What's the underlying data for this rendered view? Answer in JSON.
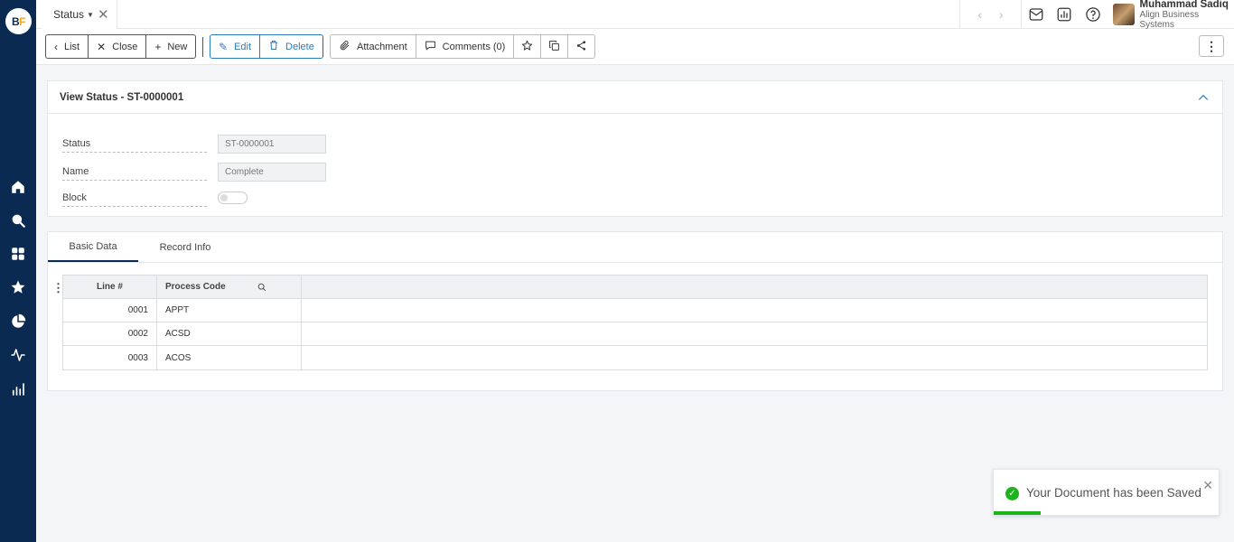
{
  "app": {
    "logo_b": "B",
    "logo_f": "F"
  },
  "sidebar": {
    "items": [
      {
        "icon": "home-icon"
      },
      {
        "icon": "search-icon"
      },
      {
        "icon": "apps-grid-icon"
      },
      {
        "icon": "star-icon"
      },
      {
        "icon": "pie-chart-icon"
      },
      {
        "icon": "activity-icon"
      },
      {
        "icon": "bar-chart-icon"
      }
    ]
  },
  "tabbar": {
    "active_tab": "Status",
    "close_glyph": "✕"
  },
  "user": {
    "name": "Muhammad Sadiq",
    "org": "Align Business Systems"
  },
  "toolbar": {
    "list_label": "List",
    "close_label": "Close",
    "new_label": "New",
    "edit_label": "Edit",
    "delete_label": "Delete",
    "attachment_label": "Attachment",
    "comments_label": "Comments (0)"
  },
  "form": {
    "title": "View Status - ST-0000001",
    "fields": {
      "status_label": "Status",
      "status_value": "ST-0000001",
      "name_label": "Name",
      "name_value": "Complete",
      "block_label": "Block",
      "block_value": false
    }
  },
  "tabs": {
    "basic_data": "Basic Data",
    "record_info": "Record Info"
  },
  "grid": {
    "headers": {
      "line": "Line #",
      "process_code": "Process Code"
    },
    "rows": [
      {
        "line": "0001",
        "code": "APPT"
      },
      {
        "line": "0002",
        "code": "ACSD"
      },
      {
        "line": "0003",
        "code": "ACOS"
      }
    ]
  },
  "toast": {
    "message": "Your Document has been Saved",
    "progress": 0.21
  },
  "colors": {
    "sidebar": "#0b2a52",
    "accent": "#2a7bbf",
    "success": "#1db31d",
    "logo_orange": "#f0a81c"
  }
}
